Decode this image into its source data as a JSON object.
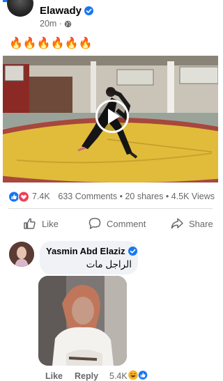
{
  "post": {
    "author": "Elawady",
    "time": "20m ·",
    "caption": "🔥🔥🔥🔥🔥🔥"
  },
  "stats": {
    "reactions": "7.4K",
    "summary": "633 Comments • 20 shares • 4.5K Views"
  },
  "actions": {
    "like": "Like",
    "comment": "Comment",
    "share": "Share"
  },
  "comment": {
    "author": "Yasmin Abd Elaziz",
    "text": "الراجل مات",
    "like": "Like",
    "reply": "Reply",
    "reaction_count": "5.4K"
  },
  "colors": {
    "brand": "#1877f2",
    "muted_text": "#65676b",
    "bubble": "#f0f2f5",
    "love": "#f33e58",
    "haha": "#f7b125"
  },
  "icons": [
    "verified-icon",
    "globe-icon",
    "play-icon",
    "like-icon",
    "comment-icon",
    "share-icon",
    "like-reaction-icon",
    "love-reaction-icon",
    "haha-reaction-icon"
  ]
}
